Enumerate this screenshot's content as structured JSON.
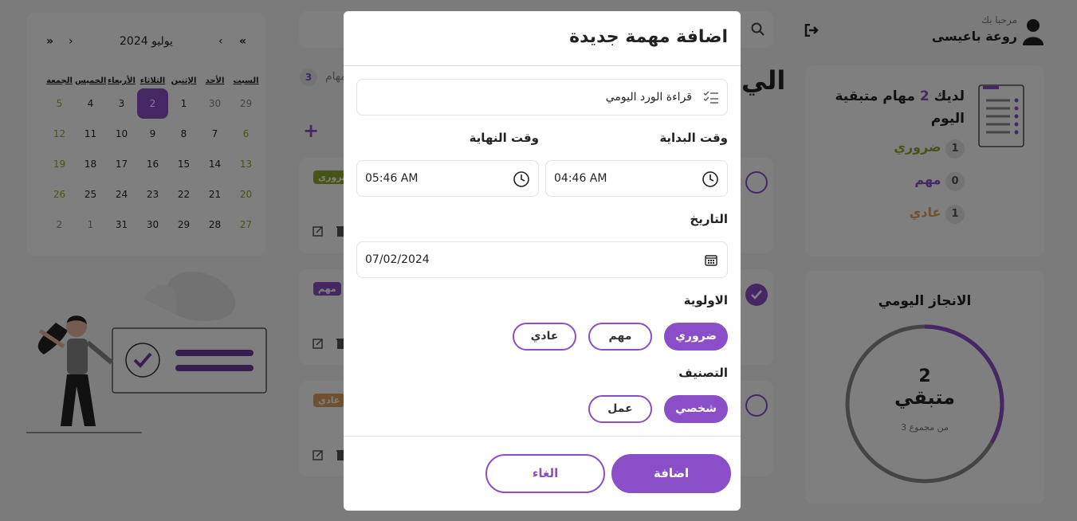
{
  "calendar": {
    "title": "يوليو 2024",
    "nav": {
      "first": "«",
      "prev": "‹",
      "next": "›",
      "last": "»"
    },
    "weekdays": [
      "السبت",
      "الأحد",
      "الإثنين",
      "الثلاثاء",
      "الأربعاء",
      "الخميس",
      "الجمعة"
    ],
    "weeks": [
      [
        "29",
        "30",
        "1",
        "2",
        "3",
        "4",
        "5"
      ],
      [
        "6",
        "7",
        "8",
        "9",
        "10",
        "11",
        "12"
      ],
      [
        "13",
        "14",
        "15",
        "16",
        "17",
        "18",
        "19"
      ],
      [
        "20",
        "21",
        "22",
        "23",
        "24",
        "25",
        "26"
      ],
      [
        "27",
        "28",
        "29",
        "30",
        "31",
        "1",
        "2"
      ]
    ],
    "selected": "2"
  },
  "user": {
    "greeting": "مرحبا بك",
    "name": "روعة باعيسى"
  },
  "summary": {
    "line1": "لديك",
    "count": "2",
    "line1b": "مهام متبقية",
    "line2": "اليوم",
    "priorities": [
      {
        "count": "1",
        "label": "ضروري",
        "color": "#8da92a"
      },
      {
        "count": "0",
        "label": "مهم",
        "color": "#8a4fc8"
      },
      {
        "count": "1",
        "label": "عادي",
        "color": "#e0a060"
      }
    ]
  },
  "progress": {
    "title": "الانجاز اليومي",
    "remaining": "2",
    "remaining_label": "متبقي",
    "total_text": "من مجموع 3",
    "fraction_done": 0.333
  },
  "tasks_panel": {
    "title_fragment": "الي",
    "count_badge": "3",
    "tasks_label": "مهام",
    "tags": [
      "ضروري",
      "مهم",
      "عادي"
    ],
    "add_symbol": "+"
  },
  "modal": {
    "title": "اضافة مهمة جديدة",
    "task_name": "قراءة الورد اليومي",
    "start_label": "وقت البداية",
    "end_label": "وقت النهاية",
    "start_time": "04:46 AM",
    "end_time": "05:46 AM",
    "date_label": "التاريخ",
    "date_value": "07/02/2024",
    "priority_label": "الاولوية",
    "priorities": [
      "ضروري",
      "مهم",
      "عادي"
    ],
    "priority_selected": "ضروري",
    "category_label": "التصنيف",
    "categories": [
      "شخصي",
      "عمل"
    ],
    "category_selected": "شخصي",
    "add_button": "اضافة",
    "cancel_button": "الغاء"
  },
  "colors": {
    "accent": "#8a4fc8",
    "urgent": "#8da92a",
    "normal": "#e0a060"
  }
}
